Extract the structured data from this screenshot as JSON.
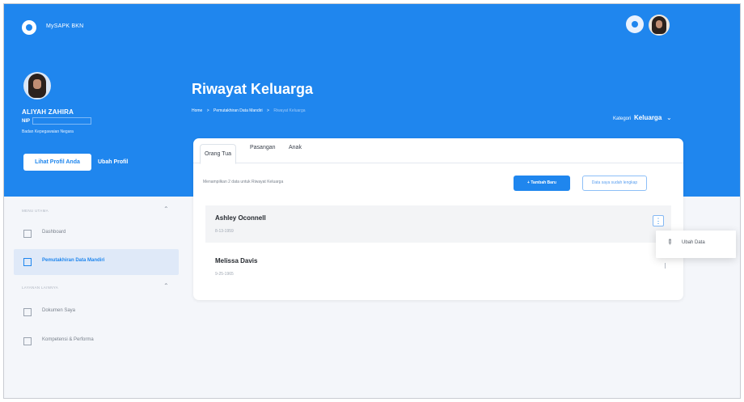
{
  "app": {
    "name": "MySAPK BKN"
  },
  "profile": {
    "name": "ALIYAH ZAHIRA",
    "nip_label": "NIP",
    "agency": "Badan Kepegawaian Negara",
    "view_profile": "Lihat Profil Anda",
    "edit_profile": "Ubah Profil"
  },
  "page": {
    "title": "Riwayat Keluarga",
    "breadcrumb": [
      "Home",
      ">",
      "Pemutakhiran Data Mandiri",
      ">",
      "Riwayat Keluarga"
    ]
  },
  "category": {
    "label": "Kategori",
    "value": "Keluarga",
    "icon": "chevron-down-icon"
  },
  "sidebar": {
    "sections": [
      {
        "title": "MENU UTAMA",
        "items": [
          {
            "label": "Dashboard",
            "active": false,
            "icon": "dashboard-icon"
          },
          {
            "label": "Pemutakhiran Data Mandiri",
            "active": true,
            "icon": "data-update-icon"
          }
        ]
      },
      {
        "title": "LAYANAN LAINNYA",
        "items": [
          {
            "label": "Dokumen Saya",
            "active": false,
            "icon": "document-icon"
          },
          {
            "label": "Kompetensi & Performa",
            "active": false,
            "icon": "competency-icon"
          }
        ]
      }
    ]
  },
  "tabs": [
    {
      "label": "Orang Tua",
      "active": true
    },
    {
      "label": "Pasangan",
      "active": false
    },
    {
      "label": "Anak",
      "active": false
    }
  ],
  "summary": "Menampilkan 2 data untuk Riwayat Keluarga",
  "actions": {
    "add": "+ Tambah Baru",
    "complete": "Data saya sudah lengkap"
  },
  "records": [
    {
      "name": "Ashley Oconnell",
      "date": "8-13-1959",
      "menu": "⋮"
    },
    {
      "name": "Melissa Davis",
      "date": "9-25-1965",
      "menu": "⋮"
    }
  ],
  "dropdown": {
    "edit_label": "Ubah Data",
    "icon": "edit-icon"
  },
  "colors": {
    "primary": "#1f86ee",
    "background": "#f4f6fa",
    "active_menu": "#dfe9f8",
    "text_dark": "#25292f",
    "text_muted": "#7a828d"
  }
}
